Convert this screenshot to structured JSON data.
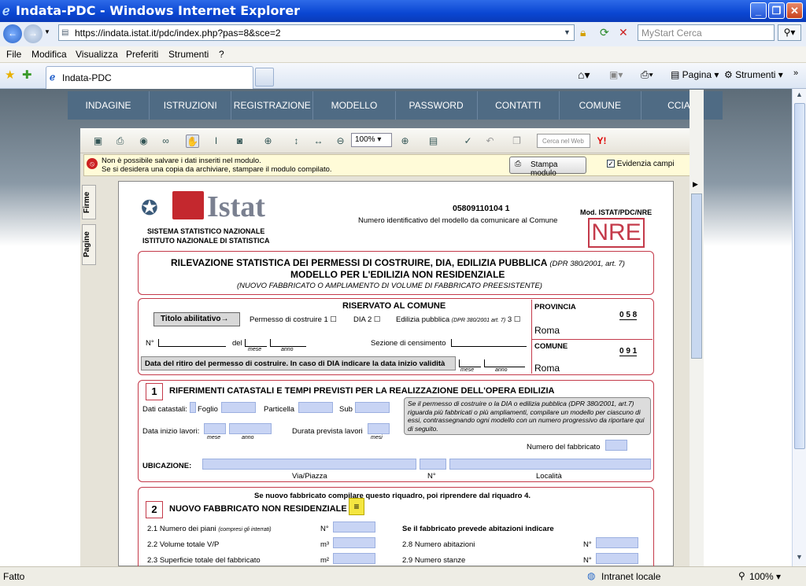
{
  "window": {
    "title": "Indata-PDC - Windows Internet Explorer"
  },
  "address": {
    "url": "https://indata.istat.it/pdc/index.php?pas=8&sce=2",
    "search_placeholder": "MyStart Cerca"
  },
  "menu": [
    "File",
    "Modifica",
    "Visualizza",
    "Preferiti",
    "Strumenti",
    "?"
  ],
  "tab": {
    "label": "Indata-PDC"
  },
  "commandbar": {
    "page": "Pagina",
    "tools": "Strumenti"
  },
  "sitenav": [
    "INDAGINE",
    "ISTRUZIONI",
    "REGISTRAZIONE",
    "MODELLO",
    "PASSWORD",
    "CONTATTI",
    "COMUNE",
    "CCIAA"
  ],
  "pdf": {
    "zoom": "100%",
    "search_placeholder": "Cerca nel Web",
    "msg1": "Non è possibile salvare i dati inseriti nel modulo.",
    "msg2": "Se si desidera una copia da archiviare, stampare il modulo compilato.",
    "print_btn": "Stampa modulo",
    "highlight": "Evidenzia campi",
    "side_tabs": [
      "Firme",
      "Pagine"
    ]
  },
  "form": {
    "logo": "Istat",
    "org1": "SISTEMA STATISTICO NAZIONALE",
    "org2": "ISTITUTO NAZIONALE DI STATISTICA",
    "code": "05809110104  1",
    "code_desc": "Numero identificativo del modello da comunicare al Comune",
    "mod": "Mod. ISTAT/PDC/NRE",
    "nre": "NRE",
    "title1": "RILEVAZIONE STATISTICA DEI PERMESSI DI COSTRUIRE, DIA, EDILIZIA PUBBLICA",
    "title1_ref": "(DPR 380/2001, art. 7)",
    "title2": "MODELLO PER L'EDILIZIA NON RESIDENZIALE",
    "title3": "(NUOVO FABBRICATO O AMPLIAMENTO DI VOLUME DI FABBRICATO PREESISTENTE)",
    "reserved": "RISERVATO AL COMUNE",
    "titolo": "Titolo abilitativo",
    "perm": "Permesso di costruire 1",
    "dia": "DIA  2",
    "edil": "Edilizia pubblica",
    "edil_ref": "(DPR 380/2001 art. 7)",
    "edil_num": "3",
    "n": "N°",
    "del": "del",
    "mese": "mese",
    "anno": "anno",
    "sezione": "Sezione di censimento",
    "ritiro": "Data del ritiro del permesso di costruire. In caso di DIA indicare la data inizio validità",
    "provincia": "PROVINCIA",
    "prov_code": "0 5 8",
    "prov_name": "Roma",
    "comune": "COMUNE",
    "com_code": "0 9 1",
    "com_name": "Roma",
    "s1_num": "1",
    "s1_title": "RIFERIMENTI CATASTALI  E TEMPI PREVISTI PER LA REALIZZAZIONE DELL'OPERA EDILIZIA",
    "dati_cat": "Dati catastali:",
    "foglio": "Foglio",
    "particella": "Particella",
    "sub": "Sub",
    "note": "Se il permesso di costruire o la DIA o edilizia pubblica (DPR 380/2001, art.7) riguarda più fabbricati o più ampliamenti, compilare un modello per ciascuno di essi, contrassegnando ogni modello con un numero progressivo da riportare qui di seguito.",
    "inizio": "Data inizio lavori:",
    "durata": "Durata prevista lavori",
    "mesi": "mesi",
    "num_fabb": "Numero del fabbricato",
    "ubic": "UBICAZIONE:",
    "via": "Via/Piazza",
    "numero": "N°",
    "localita": "Località",
    "s2_intro": "Se nuovo fabbricato compilare questo riquadro, poi riprendere dal riquadro 4.",
    "s2_num": "2",
    "s2_title": "NUOVO FABBRICATO NON RESIDENZIALE",
    "r21": "2.1  Numero dei piani",
    "r21b": "(compresi gli interrati)",
    "r22": "2.2  Volume totale V/P",
    "r23": "2.3  Superficie totale del fabbricato",
    "u_n": "N°",
    "u_m3": "m³",
    "u_m2": "m²",
    "abit": "Se il fabbricato prevede abitazioni indicare",
    "r28": "2.8  Numero abitazioni",
    "r29": "2.9  Numero stanze"
  },
  "status": {
    "left": "Fatto",
    "zone": "Intranet locale",
    "zoom": "100%"
  }
}
